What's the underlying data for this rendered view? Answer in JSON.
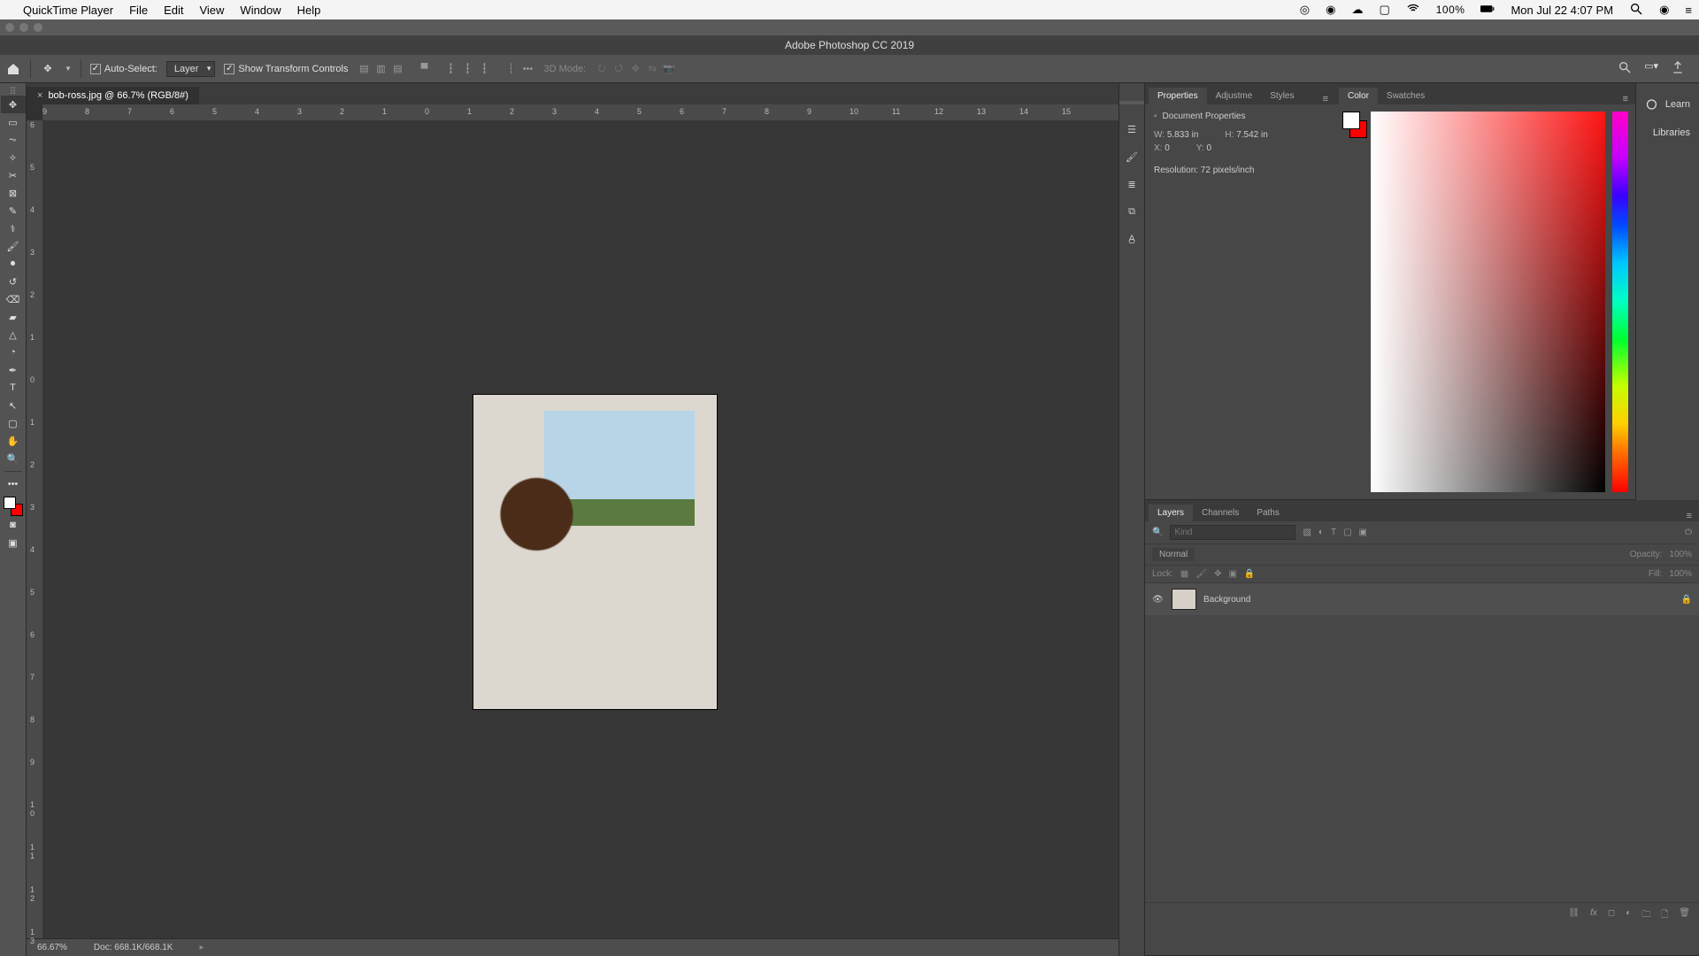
{
  "mac": {
    "app": "QuickTime Player",
    "menus": [
      "File",
      "Edit",
      "View",
      "Window",
      "Help"
    ],
    "battery_pct": "100%",
    "clock": "Mon Jul 22  4:07 PM"
  },
  "window_title": "Adobe Photoshop CC 2019",
  "options": {
    "auto_select_label": "Auto-Select:",
    "auto_select_target": "Layer",
    "transform_label": "Show Transform Controls",
    "mode_3d_label": "3D Mode:"
  },
  "doc_tab": "bob-ross.jpg @ 66.7% (RGB/8#)",
  "ruler_h": [
    "9",
    "8",
    "7",
    "6",
    "5",
    "4",
    "3",
    "2",
    "1",
    "0",
    "1",
    "2",
    "3",
    "4",
    "5",
    "6",
    "7",
    "8",
    "9",
    "10",
    "11",
    "12",
    "13",
    "14",
    "15"
  ],
  "ruler_v": [
    "6",
    "5",
    "4",
    "3",
    "2",
    "1",
    "0",
    "1",
    "2",
    "3",
    "4",
    "5",
    "6",
    "7",
    "8",
    "9",
    "1\n0",
    "1\n1",
    "1\n2",
    "1\n3"
  ],
  "status": {
    "zoom": "66.67%",
    "doc": "Doc: 668.1K/668.1K"
  },
  "panels": {
    "properties": {
      "tabs": [
        "Properties",
        "Adjustme",
        "Styles"
      ],
      "header": "Document Properties",
      "w_label": "W:",
      "w_val": "5.833 in",
      "h_label": "H:",
      "h_val": "7.542 in",
      "x_label": "X:",
      "x_val": "0",
      "y_label": "Y:",
      "y_val": "0",
      "res": "Resolution: 72 pixels/inch"
    },
    "color": {
      "tabs": [
        "Color",
        "Swatches"
      ]
    },
    "layers": {
      "tabs": [
        "Layers",
        "Channels",
        "Paths"
      ],
      "search_ph": "Kind",
      "blend_mode": "Normal",
      "opacity_label": "Opacity:",
      "opacity_val": "100%",
      "lock_label": "Lock:",
      "fill_label": "Fill:",
      "fill_val": "100%",
      "layer_name": "Background"
    }
  },
  "far_right": {
    "learn": "Learn",
    "libraries": "Libraries"
  }
}
